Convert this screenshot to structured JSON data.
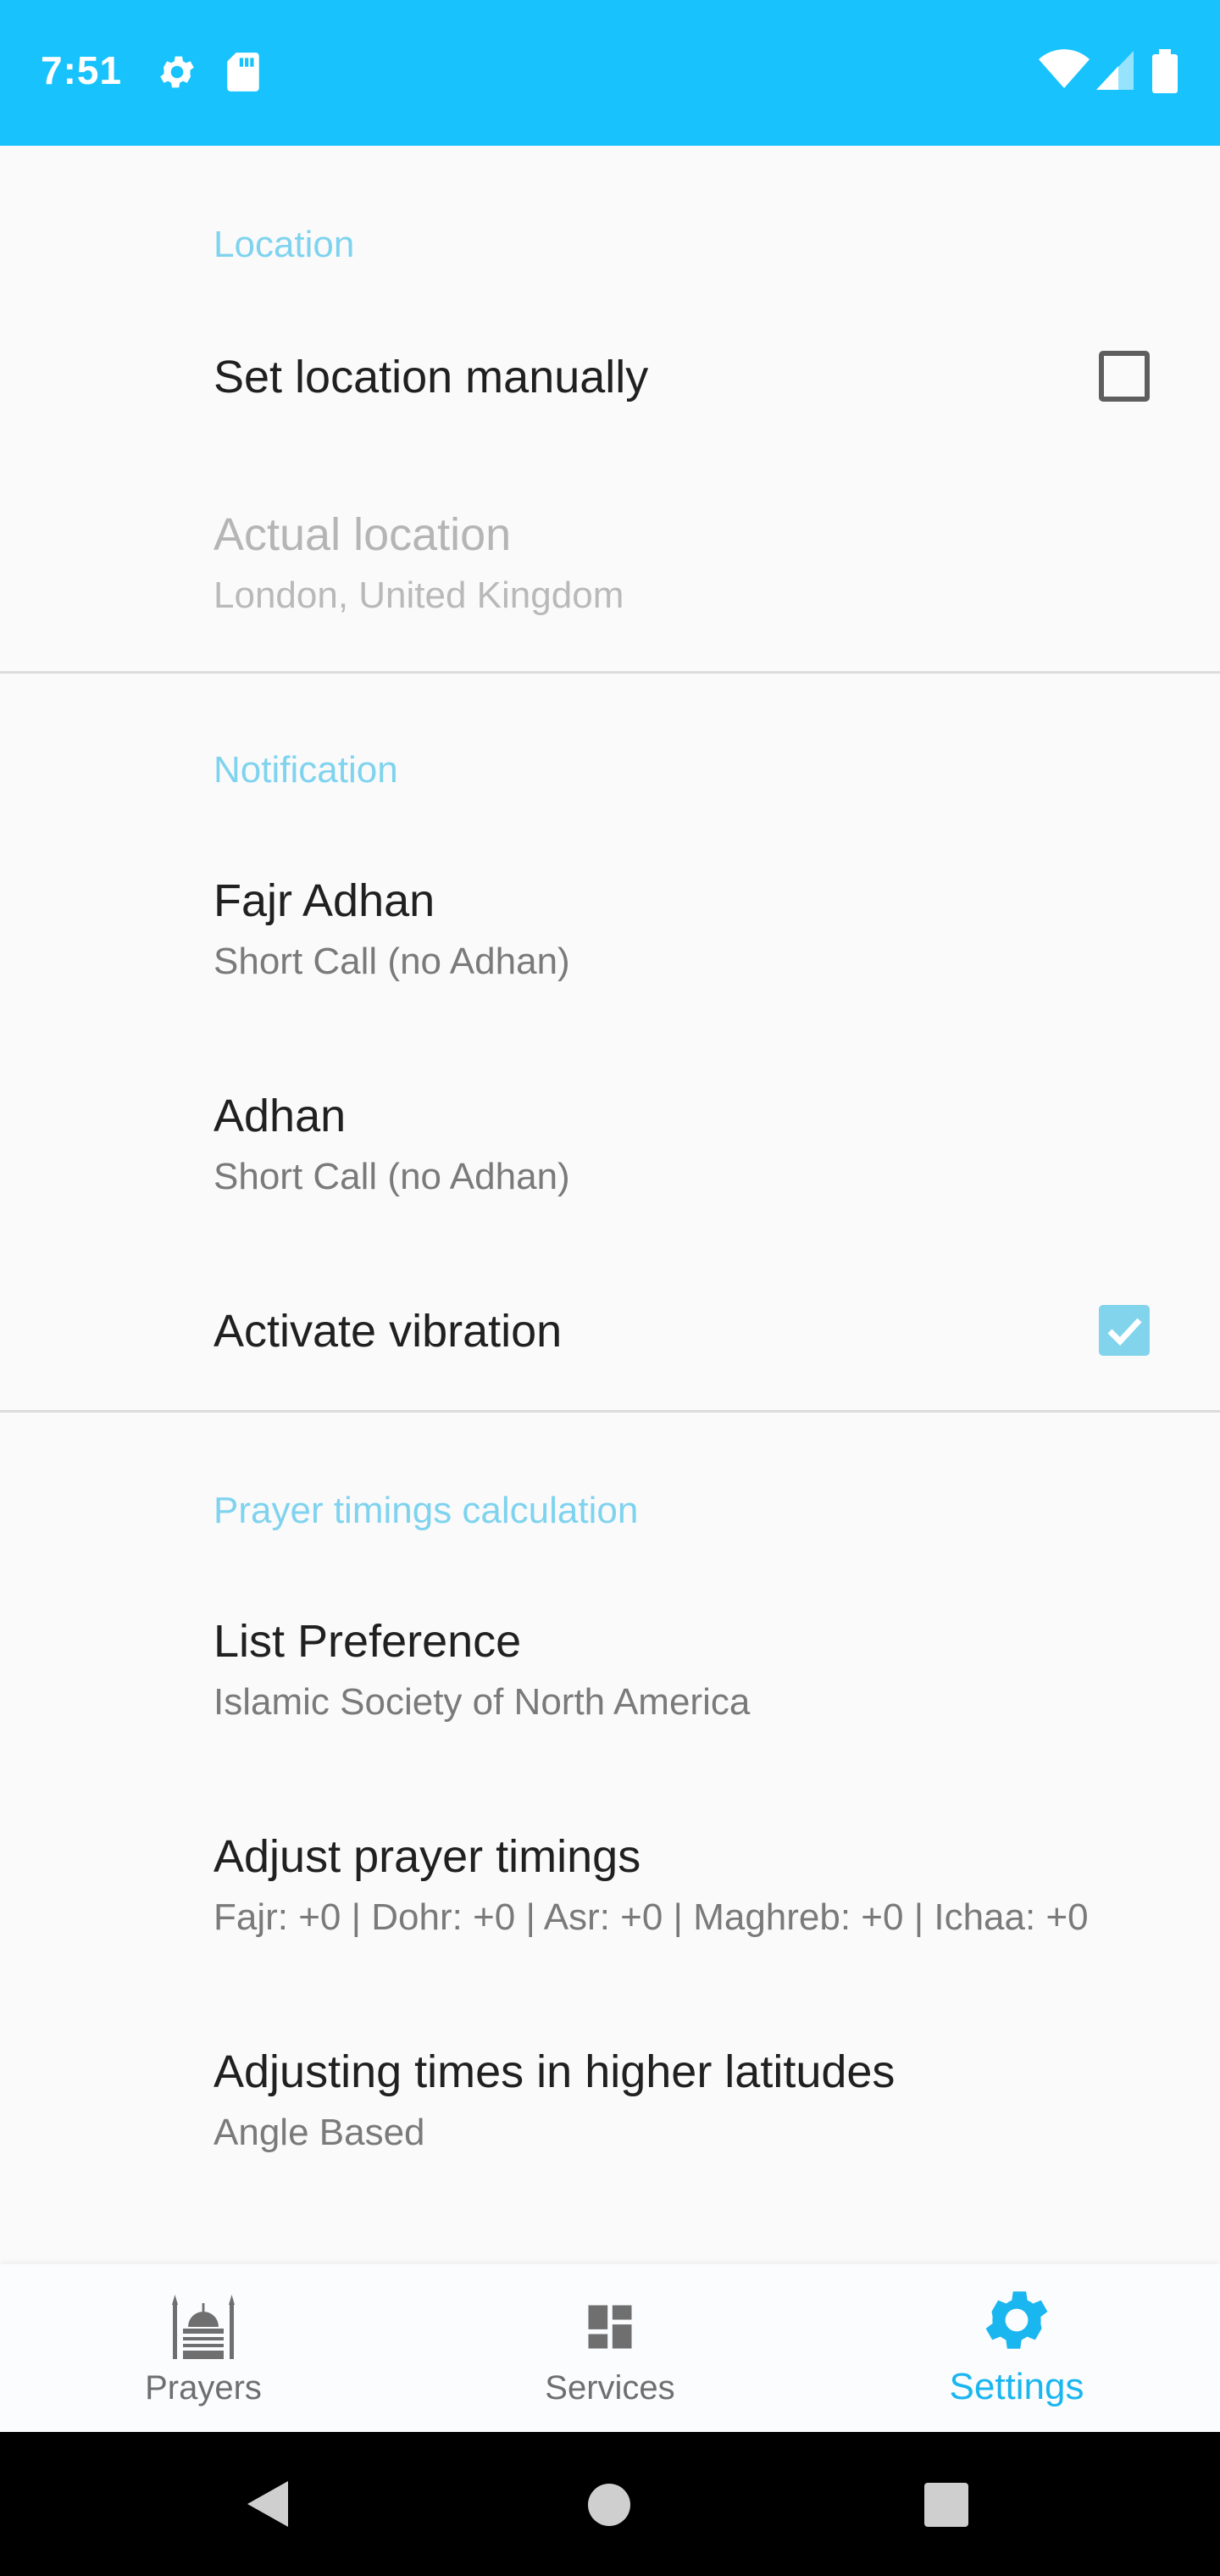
{
  "status_bar": {
    "time": "7:51",
    "icons": [
      "gear-icon",
      "sd-card-icon",
      "wifi-icon",
      "signal-icon",
      "battery-icon"
    ],
    "color": "#18c2fd"
  },
  "sections": {
    "location": {
      "header": "Location",
      "set_manually": {
        "title": "Set location manually",
        "checked": false
      },
      "actual_location": {
        "title": "Actual location",
        "summary": "London, United Kingdom"
      }
    },
    "notification": {
      "header": "Notification",
      "fajr_adhan": {
        "title": "Fajr Adhan",
        "summary": "Short Call (no Adhan)"
      },
      "adhan": {
        "title": "Adhan",
        "summary": "Short Call (no Adhan)"
      },
      "vibration": {
        "title": "Activate vibration",
        "checked": true
      }
    },
    "prayer": {
      "header": "Prayer timings calculation",
      "list_preference": {
        "title": "List Preference",
        "summary": "Islamic Society of North America"
      },
      "adjust_timings": {
        "title": "Adjust prayer timings",
        "summary": "Fajr: +0 | Dohr: +0 | Asr: +0 | Maghreb: +0 | Ichaa: +0"
      },
      "higher_latitudes": {
        "title": "Adjusting times in higher latitudes",
        "summary": "Angle Based"
      }
    }
  },
  "bottom_nav": {
    "items": [
      {
        "label": "Prayers",
        "icon": "mosque-icon"
      },
      {
        "label": "Services",
        "icon": "dashboard-icon"
      },
      {
        "label": "Settings",
        "icon": "gear-icon"
      }
    ],
    "active": "Settings",
    "accent": "#1ab6ef"
  },
  "system_nav": {
    "icons": [
      "back-icon",
      "home-icon",
      "recents-icon"
    ]
  }
}
